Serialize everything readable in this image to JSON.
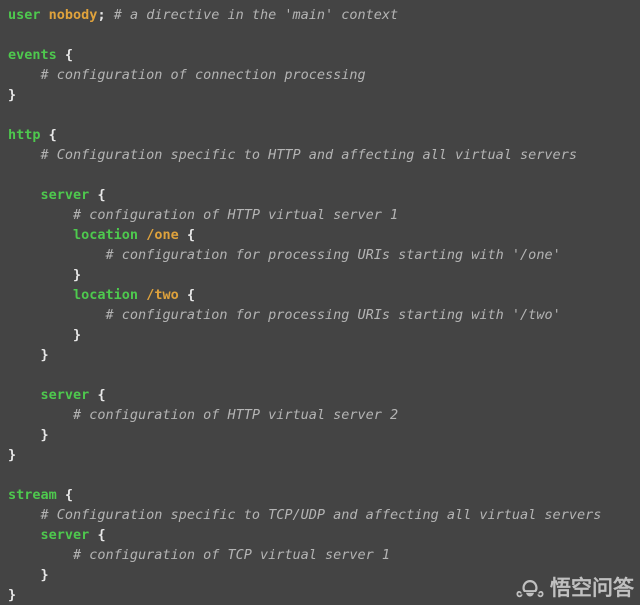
{
  "editor": {
    "background_color": "#444444",
    "keyword_color": "#4ec94e",
    "value_color": "#dfa23c",
    "comment_color": "#b4b4b4",
    "punctuation_color": "#e8e8e8",
    "language": "nginx",
    "lines": [
      {
        "indent": 0,
        "tokens": [
          {
            "type": "kw",
            "text": "user"
          },
          {
            "type": "plain",
            "text": " "
          },
          {
            "type": "val",
            "text": "nobody"
          },
          {
            "type": "punc",
            "text": ";"
          },
          {
            "type": "plain",
            "text": " "
          },
          {
            "type": "comment",
            "text": "# a directive in the 'main' context"
          }
        ]
      },
      {
        "indent": 0,
        "tokens": []
      },
      {
        "indent": 0,
        "tokens": [
          {
            "type": "kw",
            "text": "events"
          },
          {
            "type": "plain",
            "text": " "
          },
          {
            "type": "punc",
            "text": "{"
          }
        ]
      },
      {
        "indent": 1,
        "tokens": [
          {
            "type": "comment",
            "text": "# configuration of connection processing"
          }
        ]
      },
      {
        "indent": 0,
        "tokens": [
          {
            "type": "punc",
            "text": "}"
          }
        ]
      },
      {
        "indent": 0,
        "tokens": []
      },
      {
        "indent": 0,
        "tokens": [
          {
            "type": "kw",
            "text": "http"
          },
          {
            "type": "plain",
            "text": " "
          },
          {
            "type": "punc",
            "text": "{"
          }
        ]
      },
      {
        "indent": 1,
        "tokens": [
          {
            "type": "comment",
            "text": "# Configuration specific to HTTP and affecting all virtual servers"
          }
        ]
      },
      {
        "indent": 0,
        "tokens": []
      },
      {
        "indent": 1,
        "tokens": [
          {
            "type": "kw",
            "text": "server"
          },
          {
            "type": "plain",
            "text": " "
          },
          {
            "type": "punc",
            "text": "{"
          }
        ]
      },
      {
        "indent": 2,
        "tokens": [
          {
            "type": "comment",
            "text": "# configuration of HTTP virtual server 1"
          }
        ]
      },
      {
        "indent": 2,
        "tokens": [
          {
            "type": "kw",
            "text": "location"
          },
          {
            "type": "plain",
            "text": " "
          },
          {
            "type": "val",
            "text": "/one"
          },
          {
            "type": "plain",
            "text": " "
          },
          {
            "type": "punc",
            "text": "{"
          }
        ]
      },
      {
        "indent": 3,
        "tokens": [
          {
            "type": "comment",
            "text": "# configuration for processing URIs starting with '/one'"
          }
        ]
      },
      {
        "indent": 2,
        "tokens": [
          {
            "type": "punc",
            "text": "}"
          }
        ]
      },
      {
        "indent": 2,
        "tokens": [
          {
            "type": "kw",
            "text": "location"
          },
          {
            "type": "plain",
            "text": " "
          },
          {
            "type": "val",
            "text": "/two"
          },
          {
            "type": "plain",
            "text": " "
          },
          {
            "type": "punc",
            "text": "{"
          }
        ]
      },
      {
        "indent": 3,
        "tokens": [
          {
            "type": "comment",
            "text": "# configuration for processing URIs starting with '/two'"
          }
        ]
      },
      {
        "indent": 2,
        "tokens": [
          {
            "type": "punc",
            "text": "}"
          }
        ]
      },
      {
        "indent": 1,
        "tokens": [
          {
            "type": "punc",
            "text": "}"
          }
        ]
      },
      {
        "indent": 0,
        "tokens": []
      },
      {
        "indent": 1,
        "tokens": [
          {
            "type": "kw",
            "text": "server"
          },
          {
            "type": "plain",
            "text": " "
          },
          {
            "type": "punc",
            "text": "{"
          }
        ]
      },
      {
        "indent": 2,
        "tokens": [
          {
            "type": "comment",
            "text": "# configuration of HTTP virtual server 2"
          }
        ]
      },
      {
        "indent": 1,
        "tokens": [
          {
            "type": "punc",
            "text": "}"
          }
        ]
      },
      {
        "indent": 0,
        "tokens": [
          {
            "type": "punc",
            "text": "}"
          }
        ]
      },
      {
        "indent": 0,
        "tokens": []
      },
      {
        "indent": 0,
        "tokens": [
          {
            "type": "kw",
            "text": "stream"
          },
          {
            "type": "plain",
            "text": " "
          },
          {
            "type": "punc",
            "text": "{"
          }
        ]
      },
      {
        "indent": 1,
        "tokens": [
          {
            "type": "comment",
            "text": "# Configuration specific to TCP/UDP and affecting all virtual servers"
          }
        ]
      },
      {
        "indent": 1,
        "tokens": [
          {
            "type": "kw",
            "text": "server"
          },
          {
            "type": "plain",
            "text": " "
          },
          {
            "type": "punc",
            "text": "{"
          }
        ]
      },
      {
        "indent": 2,
        "tokens": [
          {
            "type": "comment",
            "text": "# configuration of TCP virtual server 1"
          }
        ]
      },
      {
        "indent": 1,
        "tokens": [
          {
            "type": "punc",
            "text": "}"
          }
        ]
      },
      {
        "indent": 0,
        "tokens": [
          {
            "type": "punc",
            "text": "}"
          }
        ]
      }
    ]
  },
  "watermark": {
    "icon": "wukong-monkey-logo-icon",
    "text": "悟空问答",
    "color": "#dcdcdc"
  }
}
